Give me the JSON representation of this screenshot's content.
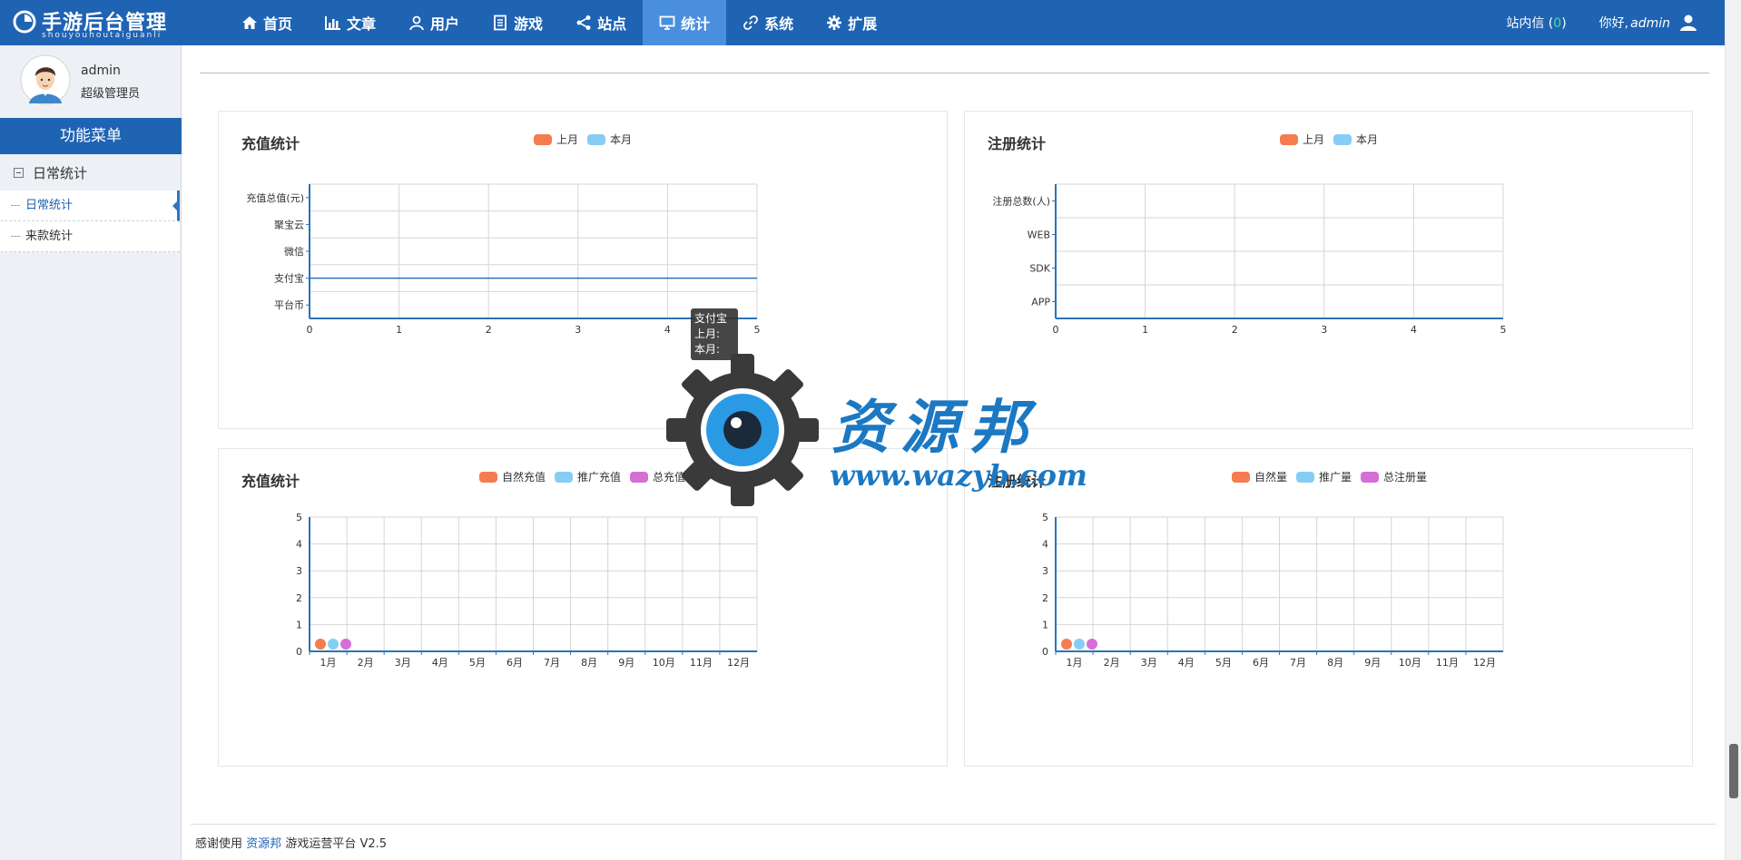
{
  "brand": {
    "title": "手游后台管理",
    "subtitle": "shouyouhoutaiguanli"
  },
  "nav": [
    {
      "label": "首页",
      "icon": "home-icon",
      "active": false
    },
    {
      "label": "文章",
      "icon": "bar-chart-icon",
      "active": false
    },
    {
      "label": "用户",
      "icon": "user-icon",
      "active": false
    },
    {
      "label": "游戏",
      "icon": "document-icon",
      "active": false
    },
    {
      "label": "站点",
      "icon": "share-icon",
      "active": false
    },
    {
      "label": "统计",
      "icon": "monitor-icon",
      "active": true
    },
    {
      "label": "系统",
      "icon": "link-icon",
      "active": false
    },
    {
      "label": "扩展",
      "icon": "gear-icon",
      "active": false
    }
  ],
  "topright": {
    "messages_label": "站内信",
    "messages_count": "0",
    "greeting": "你好,",
    "username": "admin"
  },
  "sidebar": {
    "name": "admin",
    "role": "超级管理员",
    "menu_header": "功能菜单",
    "group": "日常统计",
    "items": [
      {
        "label": "日常统计",
        "active": true
      },
      {
        "label": "来款统计",
        "active": false
      }
    ]
  },
  "colors": {
    "primary": "#1f63b3",
    "nav_active": "#4a8fde",
    "series_orange": "#f57c4e",
    "series_blue": "#86cdf5",
    "series_purple": "#d56fd6",
    "axis": "#2a73b8"
  },
  "chart_data": [
    {
      "type": "bar",
      "orientation": "horizontal",
      "title": "充值统计",
      "categories": [
        "充值总值(元)",
        "聚宝云",
        "微信",
        "支付宝",
        "平台币"
      ],
      "series": [
        {
          "name": "上月",
          "values": [
            0,
            0,
            0,
            0,
            0
          ]
        },
        {
          "name": "本月",
          "values": [
            0,
            0,
            0,
            0,
            0
          ]
        }
      ],
      "xlim": [
        0,
        5
      ],
      "x_ticks": [
        "0",
        "1",
        "2",
        "3",
        "4",
        "5"
      ],
      "grid": true,
      "legend": "top-center",
      "highlight_category": "支付宝",
      "tooltip": {
        "title": "支付宝",
        "lines": [
          "上月:",
          "本月:"
        ]
      }
    },
    {
      "type": "bar",
      "orientation": "horizontal",
      "title": "注册统计",
      "categories": [
        "注册总数(人)",
        "WEB",
        "SDK",
        "APP"
      ],
      "series": [
        {
          "name": "上月",
          "values": [
            0,
            0,
            0,
            0
          ]
        },
        {
          "name": "本月",
          "values": [
            0,
            0,
            0,
            0
          ]
        }
      ],
      "xlim": [
        0,
        5
      ],
      "x_ticks": [
        "0",
        "1",
        "2",
        "3",
        "4",
        "5"
      ],
      "grid": true,
      "legend": "top-center"
    },
    {
      "type": "line",
      "title": "充值统计",
      "categories": [
        "1月",
        "2月",
        "3月",
        "4月",
        "5月",
        "6月",
        "7月",
        "8月",
        "9月",
        "10月",
        "11月",
        "12月"
      ],
      "series": [
        {
          "name": "自然充值",
          "values": [
            0,
            0,
            0,
            0,
            0,
            0,
            0,
            0,
            0,
            0,
            0,
            0
          ]
        },
        {
          "name": "推广充值",
          "values": [
            0,
            0,
            0,
            0,
            0,
            0,
            0,
            0,
            0,
            0,
            0,
            0
          ]
        },
        {
          "name": "总充值",
          "values": [
            0,
            0,
            0,
            0,
            0,
            0,
            0,
            0,
            0,
            0,
            0,
            0
          ]
        }
      ],
      "ylim": [
        0,
        5
      ],
      "y_ticks": [
        "0",
        "1",
        "2",
        "3",
        "4",
        "5"
      ],
      "grid": true,
      "legend": "top-center"
    },
    {
      "type": "line",
      "title": "注册统计",
      "categories": [
        "1月",
        "2月",
        "3月",
        "4月",
        "5月",
        "6月",
        "7月",
        "8月",
        "9月",
        "10月",
        "11月",
        "12月"
      ],
      "series": [
        {
          "name": "自然量",
          "values": [
            0,
            0,
            0,
            0,
            0,
            0,
            0,
            0,
            0,
            0,
            0,
            0
          ]
        },
        {
          "name": "推广量",
          "values": [
            0,
            0,
            0,
            0,
            0,
            0,
            0,
            0,
            0,
            0,
            0,
            0
          ]
        },
        {
          "name": "总注册量",
          "values": [
            0,
            0,
            0,
            0,
            0,
            0,
            0,
            0,
            0,
            0,
            0,
            0
          ]
        }
      ],
      "ylim": [
        0,
        5
      ],
      "y_ticks": [
        "0",
        "1",
        "2",
        "3",
        "4",
        "5"
      ],
      "grid": true,
      "legend": "top-center"
    }
  ],
  "watermark": {
    "brand": "资源邦",
    "url": "www.wazyb.com"
  },
  "footer": {
    "prefix": "感谢使用",
    "link": "资源邦",
    "suffix": "游戏运营平台 V2.5"
  }
}
